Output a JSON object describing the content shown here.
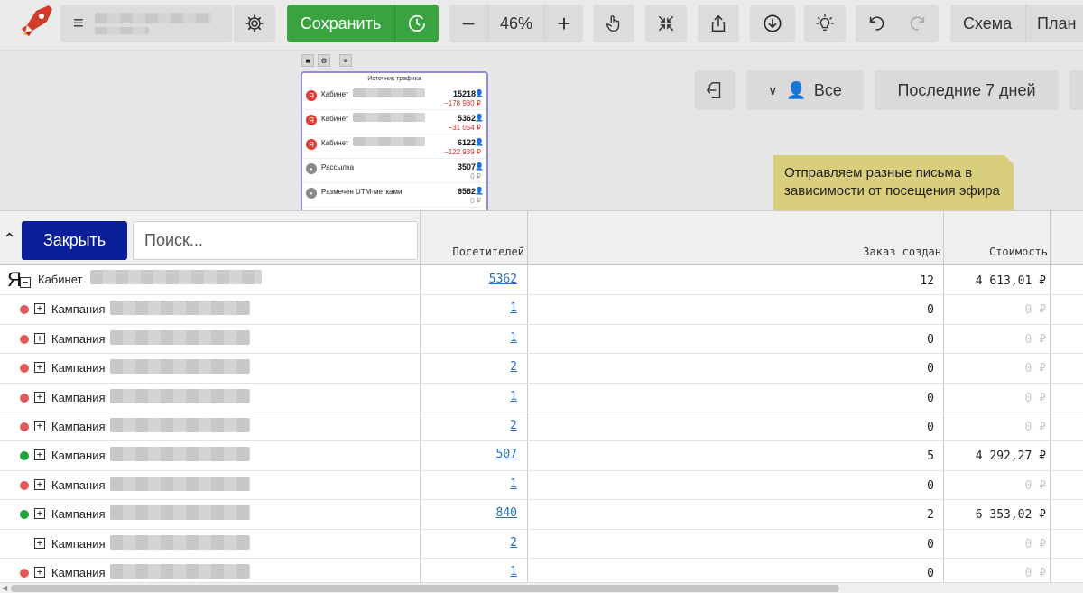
{
  "toolbar": {
    "save_label": "Сохранить",
    "zoom_value": "46%",
    "zoom_minus": "−",
    "zoom_plus": "+",
    "tab_schema": "Схема",
    "tab_plan": "План"
  },
  "canvas": {
    "node_title": "Источник трафика",
    "node_rows": [
      {
        "icon": "Я",
        "label": "Кабинет",
        "value": "15218",
        "sum": "−178 980 ₽",
        "sum_type": "neg"
      },
      {
        "icon": "Я",
        "label": "Кабинет",
        "value": "5362",
        "sum": "−31 054 ₽",
        "sum_type": "neg"
      },
      {
        "icon": "Я",
        "label": "Кабинет",
        "value": "6122",
        "sum": "−122 939 ₽",
        "sum_type": "neg"
      },
      {
        "icon": "•",
        "label": "Рассылка",
        "value": "3507",
        "sum": "0 ₽",
        "sum_type": "zero"
      },
      {
        "icon": "•",
        "label": "Размечен UTM-метками",
        "value": "6562",
        "sum": "0 ₽",
        "sum_type": "zero"
      }
    ],
    "filter_label": "Все",
    "period_label": "Последние 7 дней",
    "note_text": "Отправляем разные письма в зависимости от посещения эфира"
  },
  "table": {
    "close_label": "Закрыть",
    "search_placeholder": "Поиск...",
    "col_visitors": "Посетителей",
    "col_orders": "Заказ создан",
    "col_cost": "Стоимость",
    "parent": {
      "prefix": "Я",
      "name": "Кабинет",
      "visitors": "5362",
      "orders": "12",
      "cost": "4 613,01 ₽"
    },
    "rows": [
      {
        "name": "Кампания",
        "status": "red",
        "visitors": "1",
        "orders": "0",
        "cost": "0 ₽"
      },
      {
        "name": "Кампания",
        "status": "red",
        "visitors": "1",
        "orders": "0",
        "cost": "0 ₽"
      },
      {
        "name": "Кампания",
        "status": "red",
        "visitors": "2",
        "orders": "0",
        "cost": "0 ₽"
      },
      {
        "name": "Кампания",
        "status": "red",
        "visitors": "1",
        "orders": "0",
        "cost": "0 ₽"
      },
      {
        "name": "Кампания",
        "status": "red",
        "visitors": "2",
        "orders": "0",
        "cost": "0 ₽"
      },
      {
        "name": "Кампания",
        "status": "green",
        "visitors": "507",
        "orders": "5",
        "cost": "4 292,27 ₽"
      },
      {
        "name": "Кампания",
        "status": "red",
        "visitors": "1",
        "orders": "0",
        "cost": "0 ₽"
      },
      {
        "name": "Кампания",
        "status": "green",
        "visitors": "840",
        "orders": "2",
        "cost": "6 353,02 ₽"
      },
      {
        "name": "Кампания",
        "status": "none",
        "visitors": "2",
        "orders": "0",
        "cost": "0 ₽"
      },
      {
        "name": "Кампания",
        "status": "red",
        "visitors": "1",
        "orders": "0",
        "cost": "0 ₽"
      }
    ]
  },
  "colors": {
    "accent_green": "#3aa340",
    "close_blue": "#0a1e99",
    "status_red": "#e05a5a",
    "status_green": "#1fa33a",
    "link": "#2a70b8",
    "note": "#d8ce7b"
  }
}
